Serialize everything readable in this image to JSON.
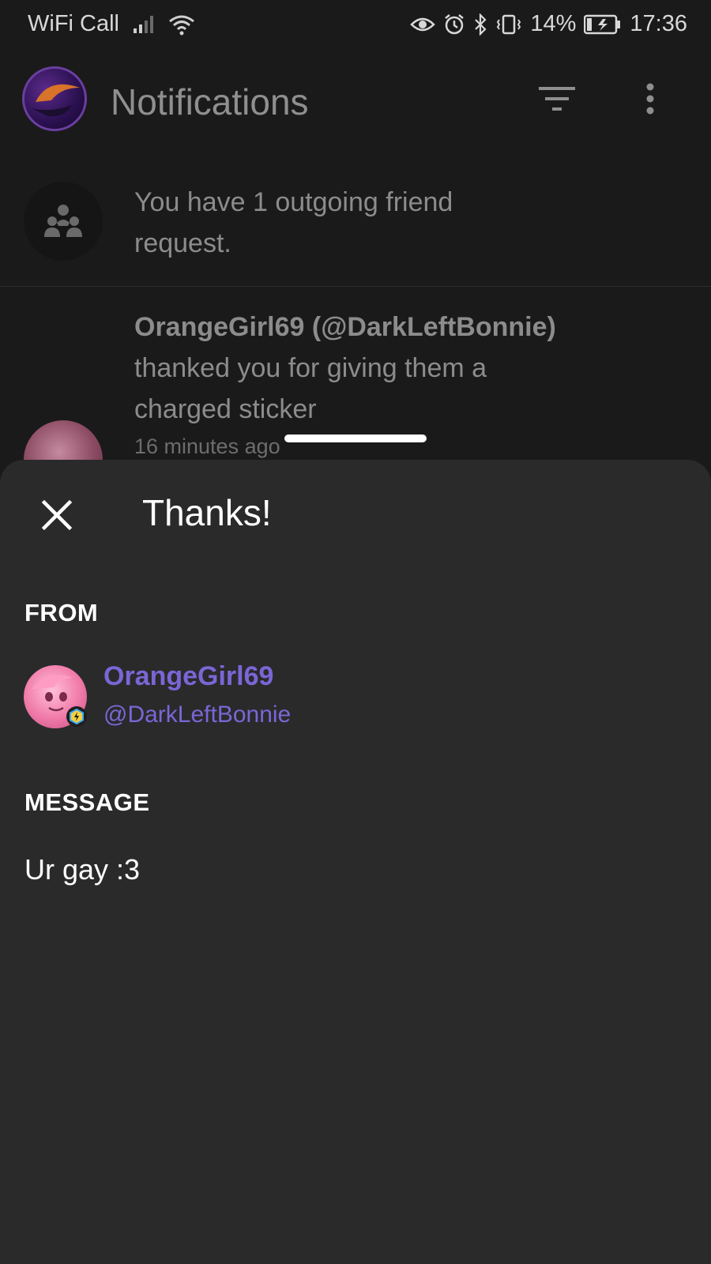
{
  "status_bar": {
    "carrier": "WiFi Call",
    "battery": "14%",
    "time": "17:36"
  },
  "app_bar": {
    "title": "Notifications"
  },
  "notifications": [
    {
      "text": "You have 1 outgoing friend request."
    },
    {
      "name": "OrangeGirl69 (@DarkLeftBonnie)",
      "line2": "thanked you for giving them a",
      "line3": "charged sticker",
      "time": "16 minutes ago"
    }
  ],
  "sheet": {
    "title": "Thanks!",
    "from_label": "FROM",
    "user_name": "OrangeGirl69",
    "user_handle": "@DarkLeftBonnie",
    "message_label": "MESSAGE",
    "message": "Ur gay :3"
  },
  "colors": {
    "background": "#1a1a1b",
    "sheet": "#2a2a2b",
    "accent": "#7b66d6"
  }
}
